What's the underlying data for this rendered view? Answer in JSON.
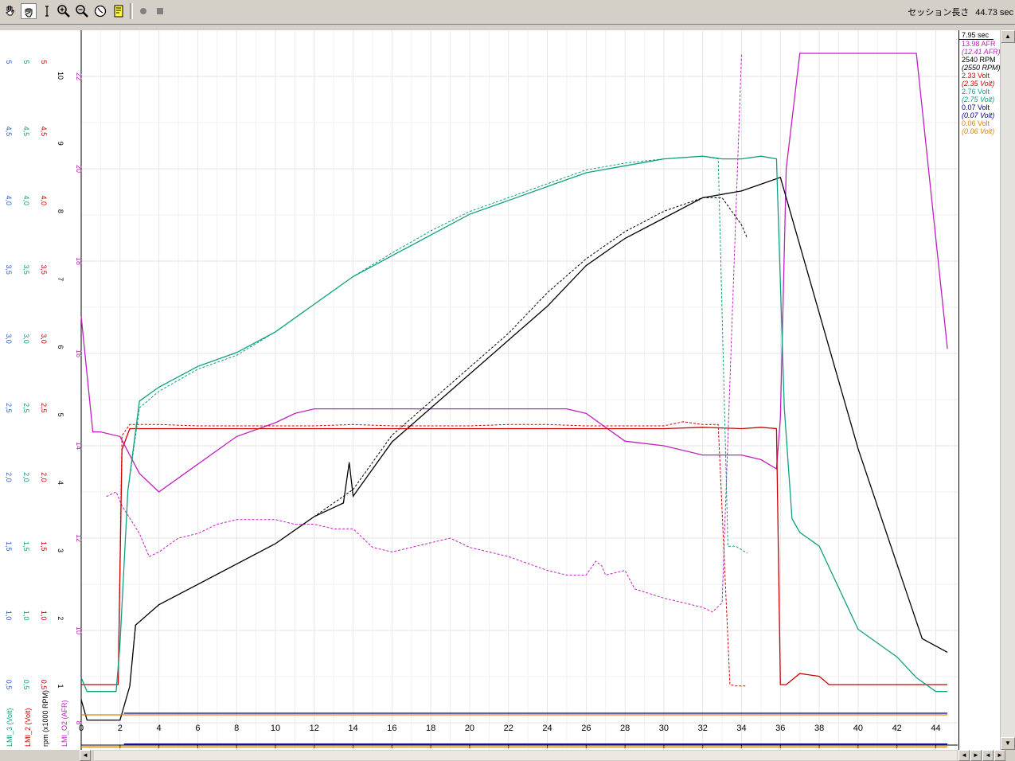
{
  "toolbar": {
    "session_label": "セッション長さ",
    "session_value": "44.73 sec",
    "buttons": [
      "hand-icon",
      "grab-icon",
      "cursor-icon",
      "zoom-in-icon",
      "zoom-out-icon",
      "clock-icon",
      "note-icon",
      "record-icon",
      "stop-icon"
    ]
  },
  "legend": {
    "items": [
      {
        "text": "7.95 sec",
        "color": "#000000",
        "italic": false
      },
      {
        "text": "13.98 AFR",
        "color": "#c020c0",
        "italic": false
      },
      {
        "text": "(12.41 AFR)",
        "color": "#c020c0",
        "italic": true
      },
      {
        "text": "2540 RPM",
        "color": "#000000",
        "italic": false
      },
      {
        "text": "(2550 RPM)",
        "color": "#000000",
        "italic": true
      },
      {
        "text": "2.33 Volt",
        "color": "#cc0000",
        "italic": false
      },
      {
        "text": "(2.35 Volt)",
        "color": "#cc0000",
        "italic": true
      },
      {
        "text": "2.76 Volt",
        "color": "#10a080",
        "italic": false
      },
      {
        "text": "(2.75 Volt)",
        "color": "#10a080",
        "italic": true
      },
      {
        "text": "0.07 Volt",
        "color": "#000080",
        "italic": false
      },
      {
        "text": "(0.07 Volt)",
        "color": "#000080",
        "italic": true
      },
      {
        "text": "0.06 Volt",
        "color": "#e08000",
        "italic": false
      },
      {
        "text": "(0.06 Volt)",
        "color": "#e08000",
        "italic": true
      }
    ]
  },
  "chart_data": {
    "type": "line",
    "xlim": [
      0,
      45
    ],
    "x_ticks": [
      0,
      2,
      4,
      6,
      8,
      10,
      12,
      14,
      16,
      18,
      20,
      22,
      24,
      26,
      28,
      30,
      32,
      34,
      36,
      38,
      40,
      42,
      44
    ],
    "axes": [
      {
        "label": "LMI_3 (Volt)",
        "color": "#3060c0",
        "ticks": [
          "0,5",
          "1,0",
          "1,5",
          "2,0",
          "2,5",
          "3,0",
          "3,5",
          "4,0",
          "4,5",
          "5"
        ],
        "tick_values": [
          0.5,
          1,
          1.5,
          2,
          2.5,
          3,
          3.5,
          4,
          4.5,
          5
        ],
        "range": [
          0,
          5
        ]
      },
      {
        "label": "LMI_3 (Volt)",
        "color": "#10a080",
        "ticks": [
          "0,5",
          "1,0",
          "1,5",
          "2,0",
          "2,5",
          "3,0",
          "3,5",
          "4,0",
          "4,5",
          "5"
        ],
        "tick_values": [
          0.5,
          1,
          1.5,
          2,
          2.5,
          3,
          3.5,
          4,
          4.5,
          5
        ],
        "range": [
          0,
          5
        ]
      },
      {
        "label": "LMI_2 (Volt)",
        "color": "#cc0000",
        "ticks": [
          "0,5",
          "1,0",
          "1,5",
          "2,0",
          "2,5",
          "3,0",
          "3,5",
          "4,0",
          "4,5",
          "5"
        ],
        "tick_values": [
          0.5,
          1,
          1.5,
          2,
          2.5,
          3,
          3.5,
          4,
          4.5,
          5
        ],
        "range": [
          0,
          5
        ]
      },
      {
        "label": "rpm (x1000 RPM)",
        "color": "#000000",
        "ticks": [
          "1",
          "2",
          "3",
          "4",
          "5",
          "6",
          "7",
          "8",
          "9",
          "10"
        ],
        "tick_values": [
          1,
          2,
          3,
          4,
          5,
          6,
          7,
          8,
          9,
          10
        ],
        "range": [
          0,
          10
        ]
      },
      {
        "label": "LMI_O2 (AFR)",
        "color": "#c020c0",
        "ticks": [
          "8",
          "10",
          "12",
          "14",
          "16",
          "18",
          "20",
          "22"
        ],
        "tick_values": [
          8,
          10,
          12,
          14,
          16,
          18,
          20,
          22
        ],
        "range": [
          7.5,
          22.5
        ]
      }
    ],
    "axis_labels": [
      "LMI_3 (Volt)",
      "LMI_2 (Volt)",
      "rpm (x1000 RPM)",
      "LMI_O2 (AFR)"
    ],
    "series": [
      {
        "name": "13.98 AFR",
        "color": "#c020c0",
        "dash": false,
        "axis": 4,
        "x": [
          0,
          0.6,
          1,
          2,
          3,
          4,
          6,
          8,
          10,
          11,
          12,
          14,
          15,
          16,
          18,
          20,
          22,
          24,
          25,
          26,
          27,
          28,
          30,
          32,
          34,
          35,
          35.8,
          36,
          36.3,
          37,
          40,
          43,
          44.6
        ],
        "y": [
          16.8,
          14.3,
          14.3,
          14.2,
          13.4,
          13.0,
          13.6,
          14.2,
          14.5,
          14.7,
          14.8,
          14.8,
          14.8,
          14.8,
          14.8,
          14.8,
          14.8,
          14.8,
          14.8,
          14.7,
          14.4,
          14.1,
          14.0,
          13.8,
          13.8,
          13.7,
          13.5,
          14.6,
          20,
          22.5,
          22.5,
          22.5,
          16.1
        ]
      },
      {
        "name": "(12.41 AFR)",
        "color": "#c020c0",
        "dash": true,
        "axis": 4,
        "x": [
          1.3,
          1.8,
          2.1,
          3,
          3.5,
          4,
          5,
          6,
          7,
          8,
          9,
          10,
          11,
          12,
          13,
          14,
          15,
          16,
          17,
          18,
          19,
          20,
          22,
          24,
          25,
          26,
          26.5,
          26.8,
          27,
          28,
          28.5,
          30,
          32,
          32.5,
          33,
          34
        ],
        "y": [
          12.9,
          13.0,
          12.7,
          12.1,
          11.6,
          11.7,
          12.0,
          12.1,
          12.3,
          12.4,
          12.4,
          12.4,
          12.3,
          12.3,
          12.2,
          12.2,
          11.8,
          11.7,
          11.8,
          11.9,
          12.0,
          11.8,
          11.6,
          11.3,
          11.2,
          11.2,
          11.5,
          11.4,
          11.2,
          11.3,
          10.9,
          10.7,
          10.5,
          10.4,
          10.6,
          22.5
        ]
      },
      {
        "name": "2540 RPM",
        "color": "#000000",
        "dash": false,
        "axis": 3,
        "x": [
          0,
          0.3,
          2,
          2.5,
          2.8,
          4,
          6,
          8,
          10,
          12,
          13.5,
          13.8,
          14,
          16,
          18,
          20,
          22,
          24,
          25,
          26,
          28,
          30,
          32,
          34,
          35,
          36,
          36.5,
          38,
          40,
          42,
          43.3,
          44.6
        ],
        "y": [
          0.8,
          0.5,
          0.5,
          1.0,
          1.9,
          2.2,
          2.5,
          2.8,
          3.1,
          3.5,
          3.7,
          4.3,
          3.8,
          4.6,
          5.1,
          5.6,
          6.1,
          6.6,
          6.9,
          7.2,
          7.6,
          7.9,
          8.2,
          8.3,
          8.4,
          8.5,
          8.0,
          6.5,
          4.5,
          2.8,
          1.7,
          1.5
        ]
      },
      {
        "name": "(2550 RPM)",
        "color": "#000000",
        "dash": true,
        "axis": 3,
        "x": [
          2.5,
          2.8,
          4,
          6,
          8,
          10,
          12,
          14,
          16,
          18,
          20,
          22,
          24,
          26,
          28,
          30,
          31,
          32,
          33,
          34,
          34.3
        ],
        "y": [
          1.0,
          1.9,
          2.2,
          2.5,
          2.8,
          3.1,
          3.5,
          3.9,
          4.7,
          5.2,
          5.7,
          6.2,
          6.8,
          7.3,
          7.7,
          8.0,
          8.1,
          8.2,
          8.2,
          7.8,
          7.6
        ]
      },
      {
        "name": "2.33 Volt",
        "color": "#cc0000",
        "dash": false,
        "axis": 2,
        "x": [
          0,
          1,
          1.9,
          2.1,
          2.5,
          4,
          6,
          8,
          10,
          12,
          14,
          16,
          18,
          20,
          22,
          24,
          26,
          28,
          30,
          32,
          34,
          35,
          35.8,
          36,
          36.3,
          37,
          38,
          38.5,
          39,
          40,
          42,
          44,
          44.6
        ],
        "y": [
          0.5,
          0.5,
          0.5,
          2.2,
          2.35,
          2.35,
          2.35,
          2.35,
          2.35,
          2.35,
          2.35,
          2.35,
          2.35,
          2.35,
          2.35,
          2.35,
          2.35,
          2.35,
          2.35,
          2.36,
          2.35,
          2.36,
          2.35,
          0.5,
          0.5,
          0.58,
          0.56,
          0.5,
          0.5,
          0.5,
          0.5,
          0.5,
          0.5
        ]
      },
      {
        "name": "(2.35 Volt)",
        "color": "#cc0000",
        "dash": true,
        "axis": 2,
        "x": [
          0,
          1,
          1.9,
          2.1,
          2.5,
          4,
          6,
          8,
          10,
          12,
          14,
          16,
          18,
          20,
          22,
          24,
          26,
          28,
          30,
          31,
          32,
          32.8,
          33.4,
          33.7,
          34.2
        ],
        "y": [
          0.5,
          0.5,
          0.5,
          2.3,
          2.38,
          2.38,
          2.37,
          2.37,
          2.37,
          2.37,
          2.38,
          2.37,
          2.37,
          2.37,
          2.38,
          2.38,
          2.37,
          2.37,
          2.37,
          2.4,
          2.38,
          2.38,
          0.5,
          0.49,
          0.49
        ]
      },
      {
        "name": "2.76 Volt",
        "color": "#10a080",
        "dash": false,
        "axis": 1,
        "x": [
          0,
          0.3,
          1,
          1.8,
          2,
          2.4,
          3,
          4,
          6,
          8,
          10,
          12,
          14,
          16,
          18,
          20,
          22,
          24,
          26,
          28,
          30,
          32,
          33,
          34,
          35,
          35.8,
          36.2,
          36.6,
          37,
          38,
          40,
          42,
          43,
          44,
          44.6
        ],
        "y": [
          0.55,
          0.45,
          0.45,
          0.45,
          0.8,
          1.9,
          2.55,
          2.65,
          2.8,
          2.9,
          3.05,
          3.25,
          3.45,
          3.6,
          3.75,
          3.9,
          4.0,
          4.1,
          4.2,
          4.25,
          4.3,
          4.32,
          4.3,
          4.3,
          4.32,
          4.3,
          2.5,
          1.7,
          1.6,
          1.5,
          0.9,
          0.7,
          0.55,
          0.45,
          0.45
        ]
      },
      {
        "name": "(2.75 Volt)",
        "color": "#10a080",
        "dash": true,
        "axis": 1,
        "x": [
          2.4,
          3,
          4,
          6,
          8,
          10,
          12,
          14,
          16,
          18,
          20,
          22,
          24,
          26,
          28,
          30,
          32,
          32.8,
          33.3,
          33.7,
          34.3
        ],
        "y": [
          1.9,
          2.5,
          2.62,
          2.78,
          2.88,
          3.05,
          3.25,
          3.45,
          3.62,
          3.78,
          3.92,
          4.02,
          4.12,
          4.22,
          4.27,
          4.3,
          4.32,
          4.3,
          1.5,
          1.5,
          1.45
        ]
      },
      {
        "name": "0.07 Volt",
        "color": "#000080",
        "dash": false,
        "axis": 0,
        "x": [
          2.2,
          44.6
        ],
        "y": [
          0.07,
          0.07
        ]
      },
      {
        "name": "0.06 Volt",
        "color": "#e08000",
        "dash": false,
        "axis": 0,
        "x": [
          0,
          44.6
        ],
        "y": [
          0.05,
          0.05
        ]
      }
    ]
  }
}
